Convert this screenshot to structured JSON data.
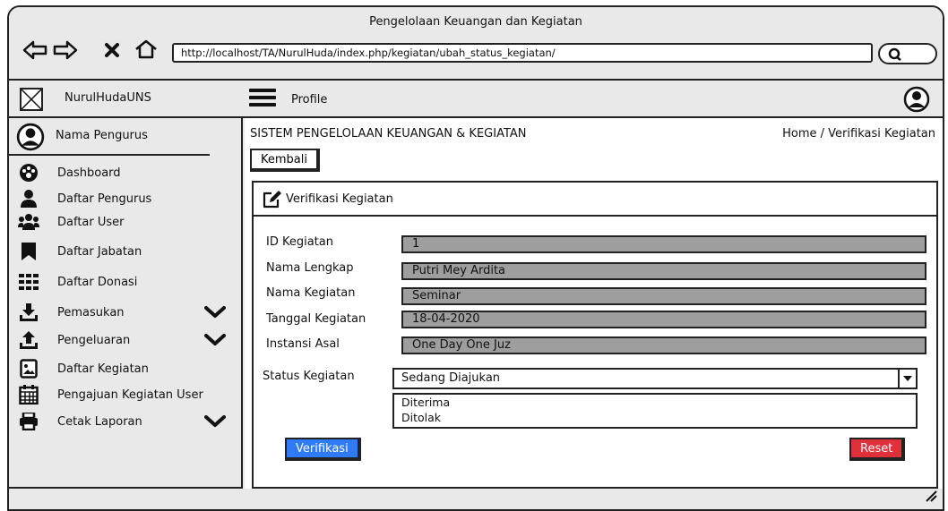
{
  "window": {
    "title": "Pengelolaan Keuangan dan Kegiatan",
    "url": "http://localhost/TA/NurulHuda/index.php/kegiatan/ubah_status_kegiatan/"
  },
  "nav_icons": [
    "back-arrow-icon",
    "forward-arrow-icon",
    "close-icon",
    "home-icon",
    "search-icon"
  ],
  "header": {
    "brand": "NurulHudaUNS",
    "profile_label": "Profile"
  },
  "sidebar": {
    "profile_name": "Nama Pengurus",
    "items": [
      {
        "label": "Dashboard",
        "icon": "dashboard-icon"
      },
      {
        "label": "Daftar Pengurus",
        "icon": "user-icon"
      },
      {
        "label": "Daftar User",
        "icon": "users-icon"
      },
      {
        "label": "Daftar Jabatan",
        "icon": "bookmark-icon"
      },
      {
        "label": "Daftar Donasi",
        "icon": "grid-icon"
      },
      {
        "label": "Pemasukan",
        "icon": "download-icon",
        "has_submenu": true
      },
      {
        "label": "Pengeluaran",
        "icon": "upload-icon",
        "has_submenu": true
      },
      {
        "label": "Daftar Kegiatan",
        "icon": "image-icon"
      },
      {
        "label": "Pengajuan Kegiatan User",
        "icon": "calendar-icon"
      },
      {
        "label": "Cetak Laporan",
        "icon": "printer-icon",
        "has_submenu": true
      }
    ]
  },
  "main": {
    "system_title": "SISTEM PENGELOLAAN KEUANGAN & KEGIATAN",
    "breadcrumb": "Home / Verifikasi Kegiatan",
    "back_label": "Kembali",
    "panel_title": "Verifikasi Kegiatan",
    "fields": [
      {
        "label": "ID Kegiatan",
        "value": "1"
      },
      {
        "label": "Nama Lengkap",
        "value": "Putri Mey Ardita"
      },
      {
        "label": "Nama Kegiatan",
        "value": "Seminar"
      },
      {
        "label": "Tanggal Kegiatan",
        "value": "18-04-2020"
      },
      {
        "label": "Instansi Asal",
        "value": "One Day One Juz"
      }
    ],
    "status": {
      "label": "Status Kegiatan",
      "selected": "Sedang Diajukan",
      "options": [
        "Diterima",
        "Ditolak"
      ]
    },
    "verify_label": "Verifikasi",
    "reset_label": "Reset"
  },
  "colors": {
    "chrome": "#e9e9e9",
    "readonly_field": "#9e9e9e",
    "verify": "#2f7bf5",
    "reset": "#e0303a"
  }
}
